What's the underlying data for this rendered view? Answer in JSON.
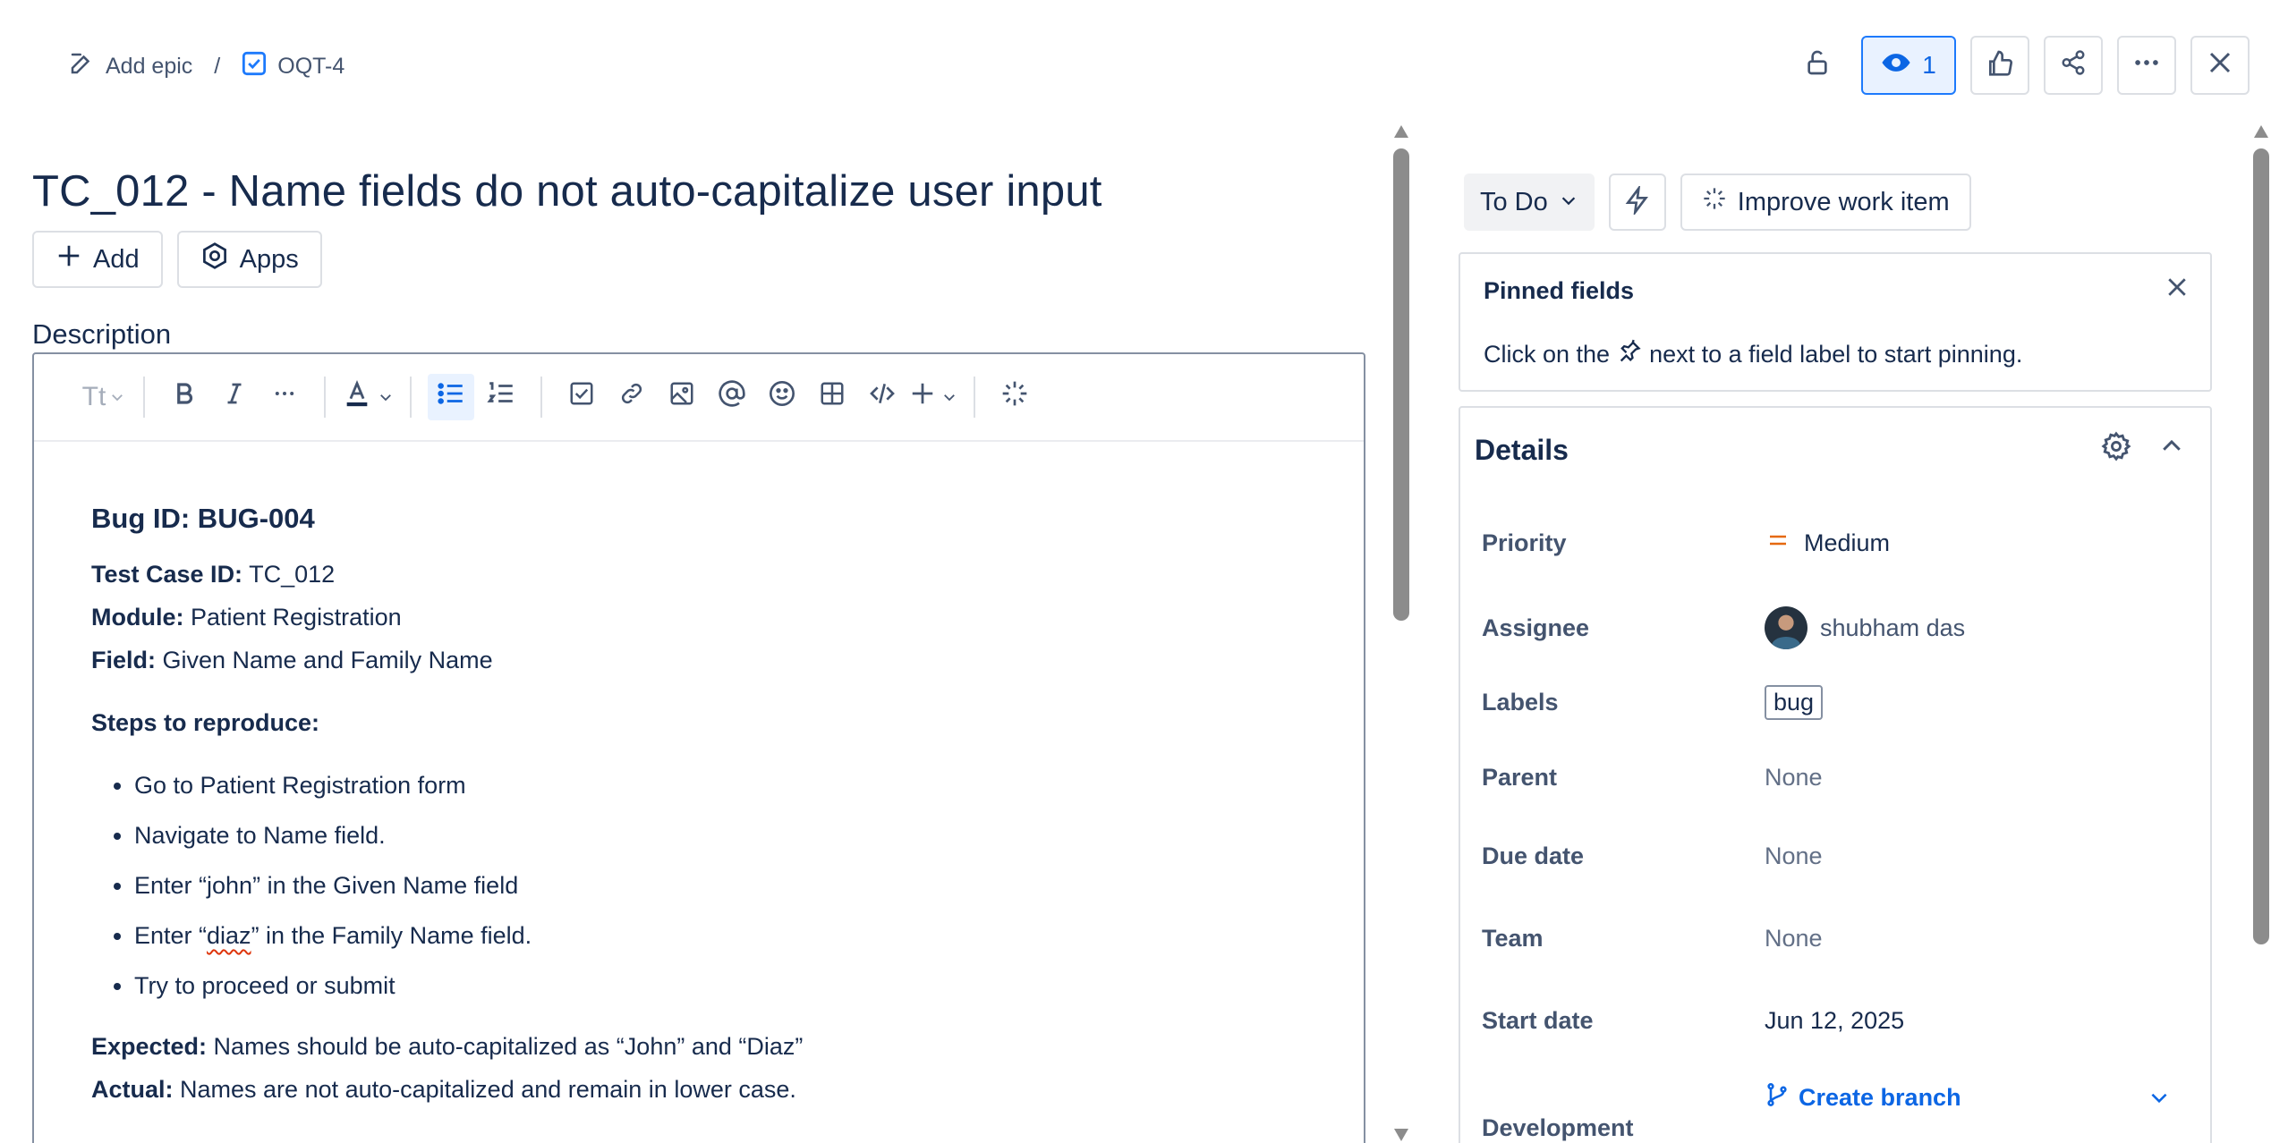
{
  "breadcrumb": {
    "epic_label": "Add epic",
    "separator": "/",
    "issue_key": "OQT-4"
  },
  "top_actions": {
    "watchers_count": "1"
  },
  "issue": {
    "title": "TC_012 - Name fields do not auto-capitalize user input",
    "add_label": "Add",
    "apps_label": "Apps"
  },
  "description": {
    "label": "Description",
    "toolbar": {
      "text_style": "Tt"
    },
    "heading": "Bug ID: BUG-004",
    "test_case_key": "Test Case ID:",
    "test_case_value": " TC_012",
    "module_key": "Module:",
    "module_value": " Patient Registration",
    "field_key": "Field:",
    "field_value": " Given Name and Family Name",
    "steps_heading": "Steps to reproduce:",
    "steps": [
      "Go to Patient Registration form",
      "Navigate to Name field.",
      "Enter “john” in the Given Name field",
      "Try to proceed or submit"
    ],
    "step4_prefix": "Enter “",
    "step4_misspelled": "diaz",
    "step4_suffix": "” in the Family Name field.",
    "expected_key": "Expected:",
    "expected_value": " Names should be auto-capitalized as “John” and “Diaz”",
    "actual_key": "Actual:",
    "actual_value": " Names are not auto-capitalized and remain in lower case."
  },
  "sidebar": {
    "status": "To Do",
    "improve_label": "Improve work item",
    "pinned": {
      "title": "Pinned fields",
      "hint_before": "Click on the",
      "hint_after": "next to a field label to start pinning."
    },
    "details": {
      "title": "Details",
      "priority_label": "Priority",
      "priority_value": "Medium",
      "priority_color": "#e56910",
      "assignee_label": "Assignee",
      "assignee_value": "shubham das",
      "labels_label": "Labels",
      "labels_value": "bug",
      "parent_label": "Parent",
      "parent_value": "None",
      "due_label": "Due date",
      "due_value": "None",
      "team_label": "Team",
      "team_value": "None",
      "start_label": "Start date",
      "start_value": "Jun 12, 2025",
      "development_label": "Development",
      "create_branch": "Create branch"
    }
  },
  "colors": {
    "accent": "#0c66e4",
    "text": "#172b4d",
    "muted": "#44546f"
  }
}
